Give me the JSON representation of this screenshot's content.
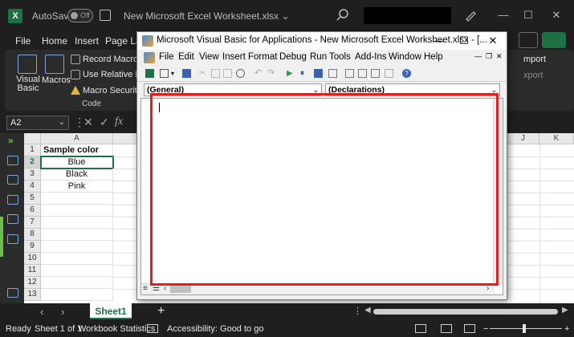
{
  "excel": {
    "titlebar": {
      "autosave_label": "AutoSave",
      "autosave_state": "Off",
      "filename": "New Microsoft Excel Worksheet.xlsx",
      "filename_chevron": "⌄",
      "logo_letter": "X"
    },
    "ribbon_tabs": [
      "File",
      "Home",
      "Insert",
      "Page La"
    ],
    "ribbon": {
      "visual_basic": "Visual Basic",
      "macros": "Macros",
      "record_macro": "Record Macro",
      "use_relative": "Use Relative Refe",
      "macro_security": "Macro Security",
      "group_label": "Code",
      "export_partial": "xport",
      "import_partial": "mport"
    },
    "namebox": "A2",
    "formula_symbols": {
      "cancel": "✕",
      "enter": "✓",
      "fx": "fx"
    },
    "columns": [
      "A"
    ],
    "right_columns": [
      "J",
      "K"
    ],
    "rows": [
      "1",
      "2",
      "3",
      "4",
      "5",
      "6",
      "7",
      "8",
      "9",
      "10",
      "11",
      "12",
      "13"
    ],
    "cells": [
      "Sample color",
      "Blue",
      "Black",
      "Pink"
    ],
    "sheet_tab": "Sheet1",
    "add_sheet": "+",
    "status": {
      "ready": "Ready",
      "sheet_info": "Sheet 1 of 1",
      "workbook_stats": "Workbook Statistics",
      "accessibility": "Accessibility: Good to go",
      "zoom_minus": "−",
      "zoom_plus": "+"
    }
  },
  "vba": {
    "title": "Microsoft Visual Basic for Applications - New Microsoft Excel Worksheet.xlsx - [...",
    "menu": [
      "File",
      "Edit",
      "View",
      "Insert",
      "Format",
      "Debug",
      "Run",
      "Tools",
      "Add-Ins",
      "Window",
      "Help"
    ],
    "object_dropdown": "(General)",
    "procedure_dropdown": "(Declarations)"
  },
  "colors": {
    "excel_green": "#1e7145",
    "highlight_red": "#e02020",
    "dark_bg": "#1f1f1f"
  }
}
